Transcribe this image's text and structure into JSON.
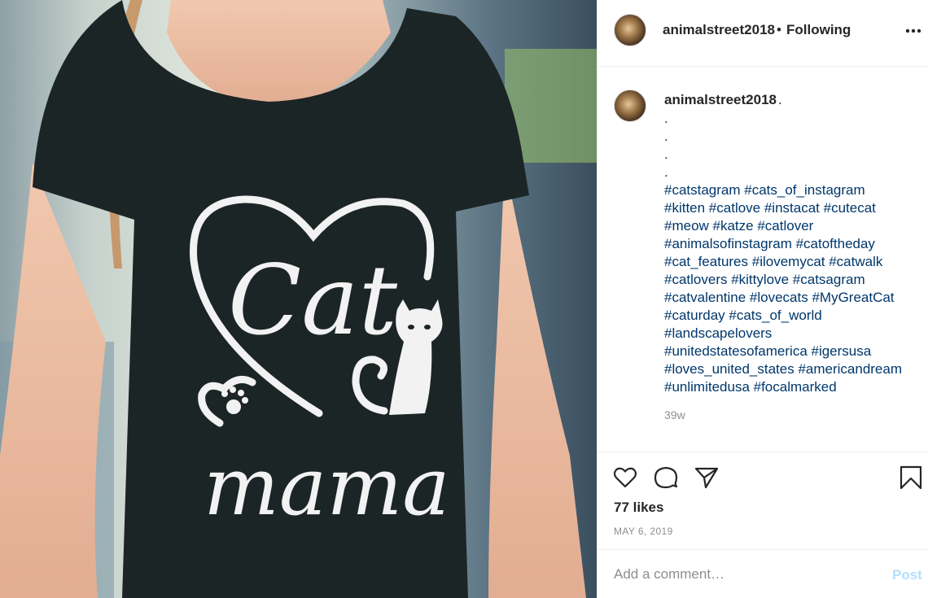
{
  "post": {
    "image_alt": "Woman wearing black t-shirt with Cat Mama heart design",
    "shirt_text_top": "Cat",
    "shirt_text_bottom": "mama"
  },
  "header": {
    "username": "animalstreet2018",
    "separator": "•",
    "follow_status": "Following",
    "more_icon": "more-dots-icon"
  },
  "caption": {
    "username": "animalstreet2018",
    "username_suffix": ".",
    "text": ".\n.\n.\n.",
    "hashtag_lines": [
      "#catstagram #cats_of_instagram",
      "#kitten #catlove #instacat #cutecat",
      "#meow #katze #catlover",
      "#animalsofinstagram #catoftheday",
      "#cat_features #ilovemycat #catwalk",
      "#catlovers #kittylove #catsagram",
      "#catvalentine #lovecats #MyGreatCat",
      "#caturday #cats_of_world",
      "#landscapelovers",
      "#unitedstatesofamerica #igersusa",
      "#loves_united_states #americandream",
      "#unlimitedusa #focalmarked"
    ],
    "time_ago": "39w"
  },
  "actions": {
    "like_icon": "heart-icon",
    "comment_icon": "comment-icon",
    "share_icon": "share-icon",
    "save_icon": "bookmark-icon",
    "likes_text": "77 likes",
    "date": "MAY 6, 2019"
  },
  "comment": {
    "placeholder": "Add a comment…",
    "post_label": "Post"
  },
  "colors": {
    "hashtag": "#00376b",
    "muted": "#8e8e8e",
    "post_button": "#b2dffc",
    "shirt": "#1c2526"
  }
}
